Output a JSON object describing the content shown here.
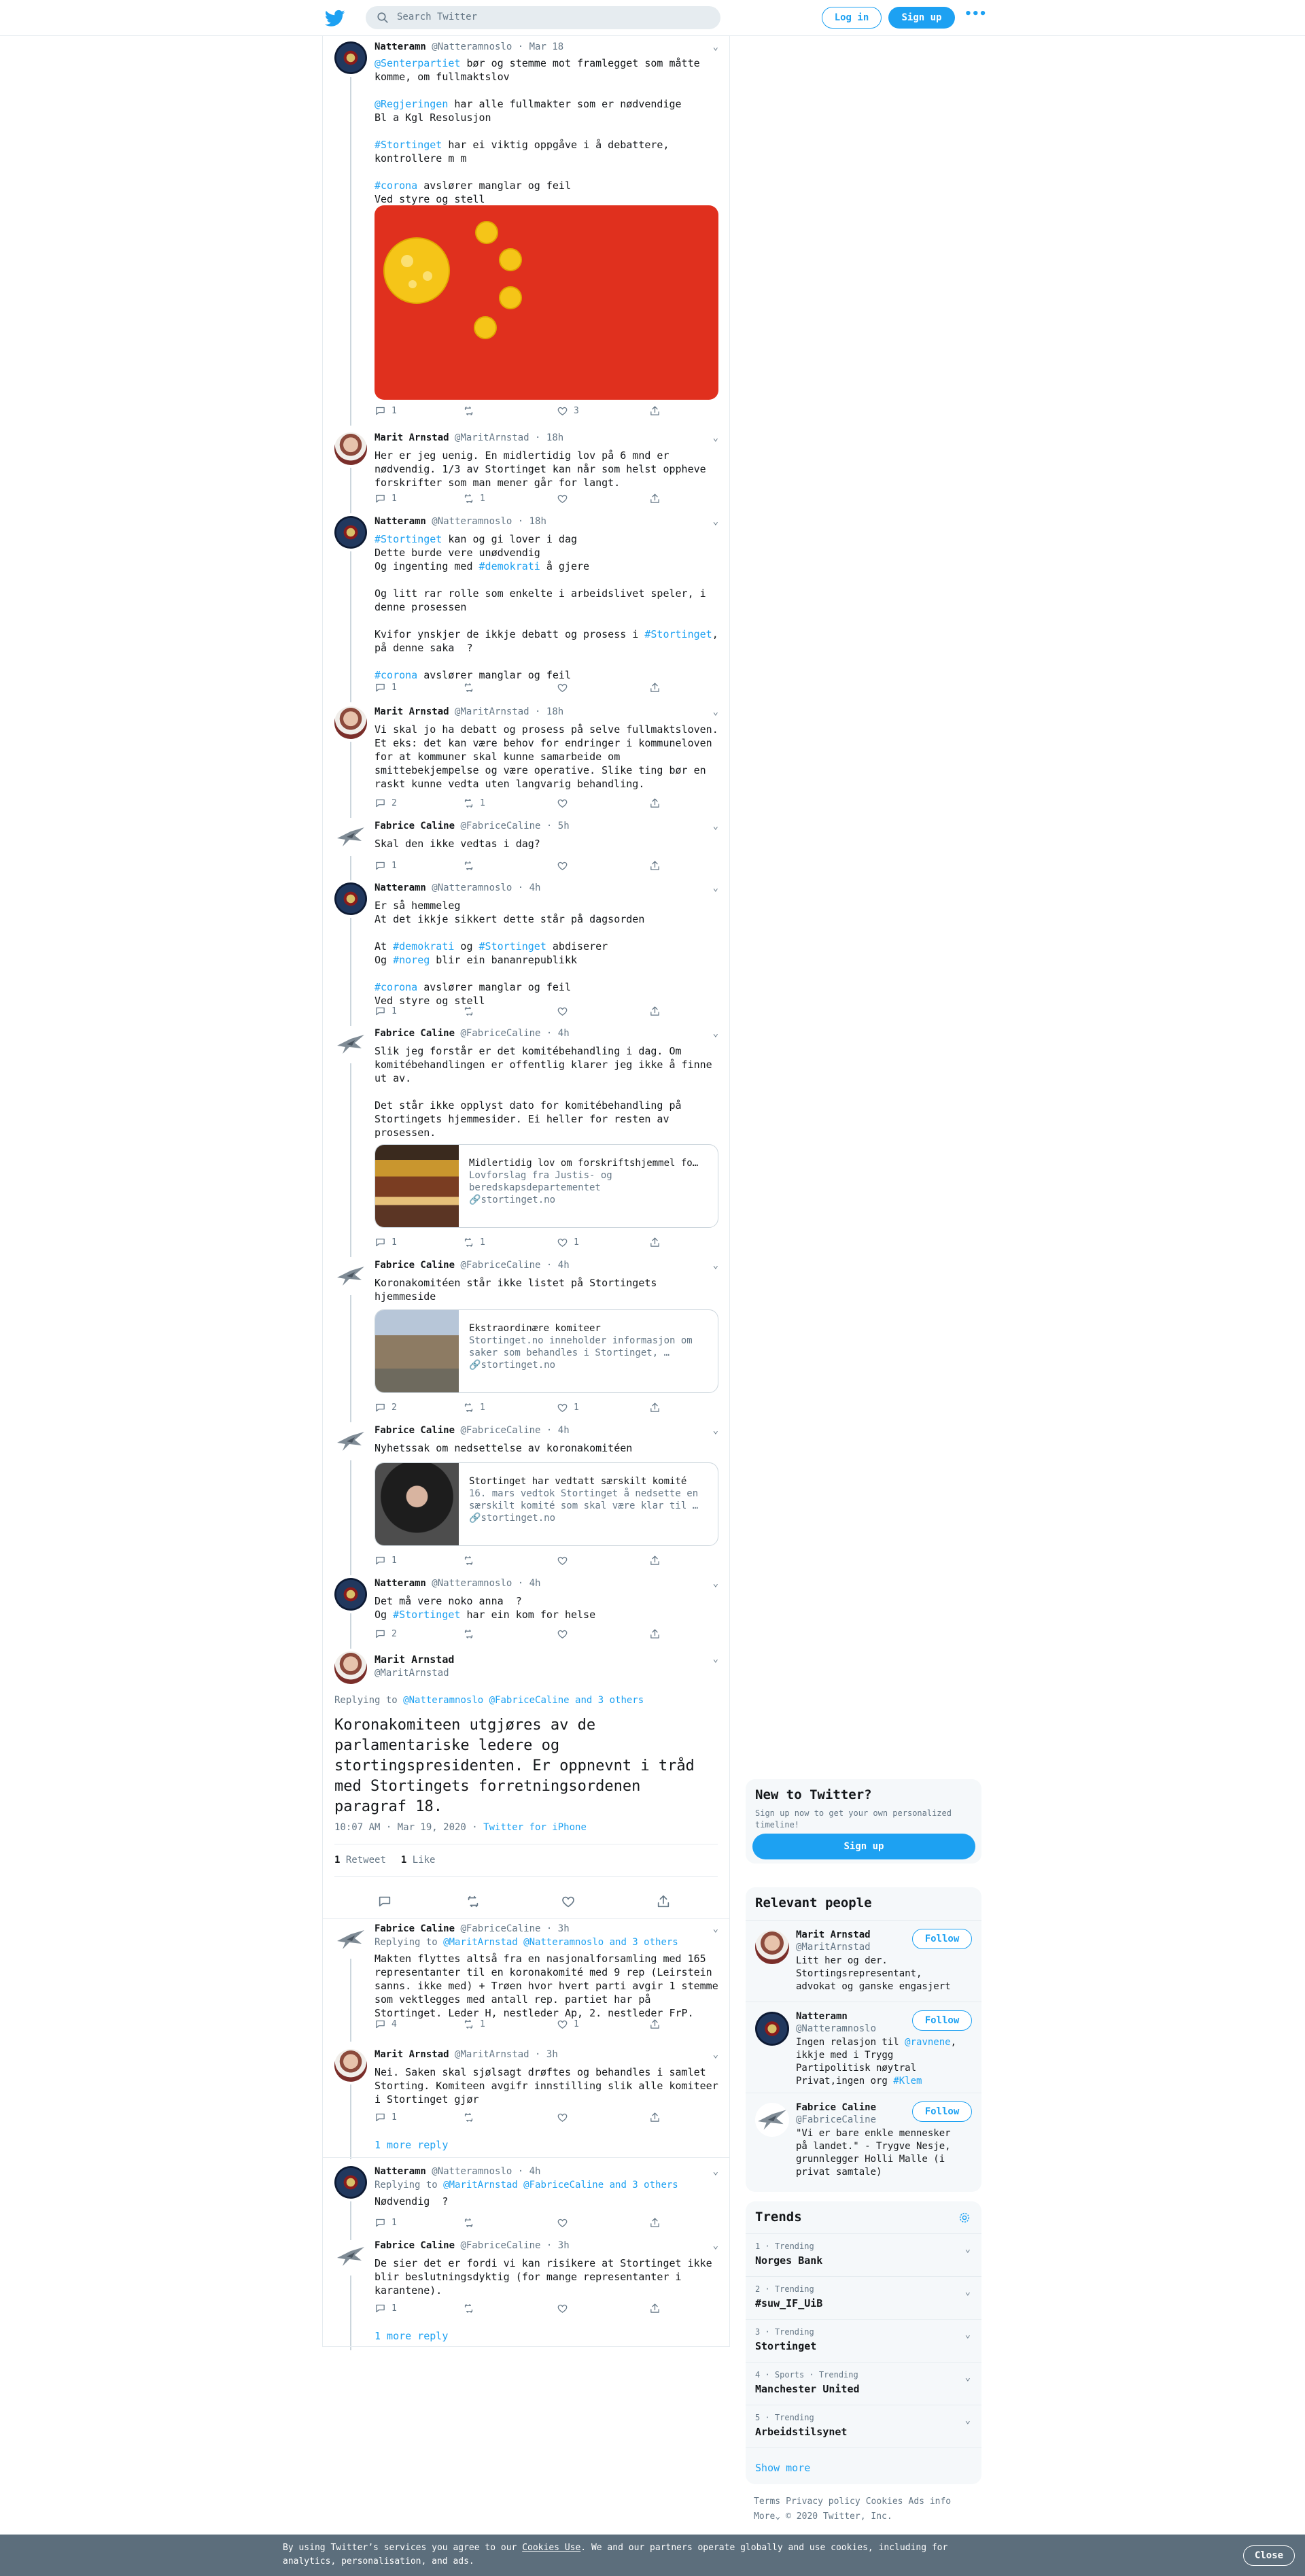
{
  "header": {
    "search_placeholder": "Search Twitter",
    "login_label": "Log in",
    "signup_label": "Sign up",
    "more_label": "•••",
    "icons": {
      "logo": "twitter-bird-icon",
      "search": "search-icon"
    }
  },
  "colors": {
    "accent": "#1da1f2",
    "text": "#14171a",
    "muted": "#657786",
    "border": "#e6ecf0",
    "cookie_bg": "#5c6e7c"
  },
  "tweets": [
    {
      "name": "Natteramn",
      "handle": "@Natteramnoslo",
      "time": "· Mar 18",
      "segments": [
        [
          {
            "t": "@Senterpartiet",
            "l": true
          },
          {
            "t": " bør og stemme mot framlegget som måtte komme, om fullmaktslov"
          }
        ],
        [
          {
            "t": ""
          }
        ],
        [
          {
            "t": "@Regjeringen",
            "l": true
          },
          {
            "t": " har alle fullmakter som er nødvendige"
          }
        ],
        [
          {
            "t": "Bl a Kgl Resolusjon"
          }
        ],
        [
          {
            "t": ""
          }
        ],
        [
          {
            "t": "#Stortinget",
            "l": true
          },
          {
            "t": " har ei viktig oppgåve i å debattere, kontrollere m m"
          }
        ],
        [
          {
            "t": ""
          }
        ],
        [
          {
            "t": "#corona",
            "l": true
          },
          {
            "t": " avslører manglar og feil"
          }
        ],
        [
          {
            "t": "Ved styre og stell"
          }
        ]
      ],
      "replies": "1",
      "retweets": "",
      "likes": "3"
    },
    {
      "name": "Marit Arnstad",
      "handle": "@MaritArnstad",
      "time": "· 18h",
      "segments": [
        [
          {
            "t": "Her er jeg uenig. En midlertidig lov på 6 mnd er nødvendig. 1/3 av Stortinget kan når som helst oppheve forskrifter som man mener går for langt."
          }
        ]
      ],
      "replies": "1",
      "retweets": "1",
      "likes": ""
    },
    {
      "name": "Natteramn",
      "handle": "@Natteramnoslo",
      "time": "· 18h",
      "segments": [
        [
          {
            "t": "#Stortinget",
            "l": true
          },
          {
            "t": " kan og gi lover i dag"
          }
        ],
        [
          {
            "t": "Dette burde vere unødvendig"
          }
        ],
        [
          {
            "t": "Og ingenting med "
          },
          {
            "t": "#demokrati",
            "l": true
          },
          {
            "t": " å gjere"
          }
        ],
        [
          {
            "t": ""
          }
        ],
        [
          {
            "t": "Og litt rar rolle som enkelte i arbeidslivet speler, i denne prosessen"
          }
        ],
        [
          {
            "t": ""
          }
        ],
        [
          {
            "t": "Kvifor ynskjer de ikkje debatt og prosess i "
          },
          {
            "t": "#Stortinget",
            "l": true
          },
          {
            "t": ", på denne saka  ?"
          }
        ],
        [
          {
            "t": ""
          }
        ],
        [
          {
            "t": "#corona",
            "l": true
          },
          {
            "t": " avslører manglar og feil"
          }
        ]
      ],
      "replies": "1",
      "retweets": "",
      "likes": ""
    },
    {
      "name": "Marit Arnstad",
      "handle": "@MaritArnstad",
      "time": "· 18h",
      "segments": [
        [
          {
            "t": "Vi skal jo ha debatt og prosess på selve fullmaktsloven. Et eks: det kan være behov for endringer i kommuneloven for at kommuner skal kunne samarbeide om smittebekjempelse og være operative. Slike ting bør en raskt kunne vedta uten langvarig behandling."
          }
        ]
      ],
      "replies": "2",
      "retweets": "1",
      "likes": ""
    },
    {
      "name": "Fabrice Caline",
      "handle": "@FabriceCaline",
      "time": "· 5h",
      "segments": [
        [
          {
            "t": "Skal den ikke vedtas i dag?"
          }
        ]
      ],
      "replies": "1",
      "retweets": "",
      "likes": ""
    },
    {
      "name": "Natteramn",
      "handle": "@Natteramnoslo",
      "time": "· 4h",
      "segments": [
        [
          {
            "t": "Er så hemmeleg"
          }
        ],
        [
          {
            "t": "At det ikkje sikkert dette står på dagsorden"
          }
        ],
        [
          {
            "t": ""
          }
        ],
        [
          {
            "t": "At "
          },
          {
            "t": "#demokrati",
            "l": true
          },
          {
            "t": " og "
          },
          {
            "t": "#Stortinget",
            "l": true
          },
          {
            "t": " abdiserer"
          }
        ],
        [
          {
            "t": "Og "
          },
          {
            "t": "#noreg",
            "l": true
          },
          {
            "t": " blir ein bananrepublikk"
          }
        ],
        [
          {
            "t": ""
          }
        ],
        [
          {
            "t": "#corona",
            "l": true
          },
          {
            "t": " avslører manglar og feil"
          }
        ],
        [
          {
            "t": "Ved styre og stell"
          }
        ]
      ],
      "replies": "1",
      "retweets": "",
      "likes": ""
    },
    {
      "name": "Fabrice Caline",
      "handle": "@FabriceCaline",
      "time": "· 4h",
      "segments": [
        [
          {
            "t": "Slik jeg forstår er det komitébehandling i dag. Om komitébehandlingen er offentlig klarer jeg ikke å finne ut av."
          }
        ],
        [
          {
            "t": ""
          }
        ],
        [
          {
            "t": "Det står ikke opplyst dato for komitébehandling på Stortingets hjemmesider. Ei heller for resten av prosessen."
          }
        ]
      ],
      "card": {
        "title": "Midlertidig lov om forskriftshjemmel fo…",
        "desc": "Lovforslag fra Justis- og beredskapsdepartementet",
        "url": "stortinget.no"
      },
      "replies": "1",
      "retweets": "1",
      "likes": "1"
    },
    {
      "name": "Fabrice Caline",
      "handle": "@FabriceCaline",
      "time": "· 4h",
      "segments": [
        [
          {
            "t": "Koronakomitéen står ikke listet på Stortingets hjemmeside"
          }
        ]
      ],
      "card": {
        "title": "Ekstraordinære komiteer",
        "desc": "Stortinget.no inneholder informasjon om saker som behandles i Stortinget, …",
        "url": "stortinget.no"
      },
      "replies": "2",
      "retweets": "1",
      "likes": "1"
    },
    {
      "name": "Fabrice Caline",
      "handle": "@FabriceCaline",
      "time": "· 4h",
      "segments": [
        [
          {
            "t": "Nyhetssak om nedsettelse av koronakomitéen"
          }
        ]
      ],
      "card": {
        "title": "Stortinget har vedtatt særskilt komité",
        "desc": "16. mars vedtok Stortinget å nedsette en særskilt komité som skal være klar til …",
        "url": "stortinget.no"
      },
      "replies": "1",
      "retweets": "",
      "likes": ""
    },
    {
      "name": "Natteramn",
      "handle": "@Natteramnoslo",
      "time": "· 4h",
      "segments": [
        [
          {
            "t": "Det må vere noko anna  ?"
          }
        ],
        [
          {
            "t": "Og "
          },
          {
            "t": "#Stortinget",
            "l": true
          },
          {
            "t": " har ein kom for helse"
          }
        ]
      ],
      "replies": "2",
      "retweets": "",
      "likes": ""
    }
  ],
  "focus": {
    "name": "Marit Arnstad",
    "handle": "@MaritArnstad",
    "replying_prefix": "Replying to ",
    "replying_to": "@Natteramnoslo @FabriceCaline and 3 others",
    "text": "Koronakomiteen utgjøres av de parlamentariske ledere og stortingspresidenten. Er oppnevnt i tråd med Stortingets forretningsordenen paragraf 18.",
    "timestamp": "10:07 AM · Mar 19, 2020 · ",
    "source": "Twitter for iPhone",
    "retweets_count": "1",
    "retweets_label": "Retweet",
    "likes_count": "1",
    "likes_label": "Like"
  },
  "replies": [
    {
      "name": "Fabrice Caline",
      "handle": "@FabriceCaline",
      "time": "· 3h",
      "replying_prefix": "Replying to ",
      "replying_to": "@MaritArnstad @Natteramnoslo and 3 others",
      "text": "Makten flyttes altså fra en nasjonalforsamling med 165 representanter til en koronakomité med 9 rep (Leirstein sanns. ikke med) + Trøen hvor hvert parti avgir 1 stemme som vektlegges med antall rep. partiet har på Stortinget. Leder H, nestleder Ap, 2. nestleder FrP.",
      "replies": "4",
      "retweets": "1",
      "likes": "1"
    },
    {
      "name": "Marit Arnstad",
      "handle": "@MaritArnstad",
      "time": "· 3h",
      "text": "Nei. Saken skal sjølsagt drøftes og behandles i samlet Storting. Komiteen avgifr innstilling slik alle komiteer i Stortinget gjør",
      "replies": "1",
      "retweets": "",
      "likes": ""
    },
    {
      "name": "Natteramn",
      "handle": "@Natteramnoslo",
      "time": "· 4h",
      "replying_prefix": "Replying to ",
      "replying_to": "@MaritArnstad @FabriceCaline and 3 others",
      "text": "Nødvendig  ?",
      "replies": "1",
      "retweets": "",
      "likes": ""
    },
    {
      "name": "Fabrice Caline",
      "handle": "@FabriceCaline",
      "time": "· 3h",
      "text": "De sier det er fordi vi kan risikere at Stortinget ikke blir beslutningsdyktig (for mange representanter i karantene).",
      "replies": "1",
      "retweets": "",
      "likes": ""
    }
  ],
  "more_reply_label": "1 more reply",
  "sidebar": {
    "new_title": "New to Twitter?",
    "new_desc": "Sign up now to get your own personalized timeline!",
    "new_signup": "Sign up",
    "relevant_title": "Relevant people",
    "follow_label": "Follow",
    "people": [
      {
        "name": "Marit Arnstad",
        "handle": "@MaritArnstad",
        "bio": [
          {
            "t": "Litt her og der. Stortingsrepresentant, advokat og ganske engasjert"
          }
        ]
      },
      {
        "name": "Natteramn",
        "handle": "@Natteramnoslo",
        "bio": [
          {
            "t": "Ingen relasjon til "
          },
          {
            "t": "@ravnene",
            "l": true
          },
          {
            "t": ", ikkje med i Trygg Partipolitisk nøytral Privat,ingen org "
          },
          {
            "t": "#Klem",
            "l": true
          }
        ]
      },
      {
        "name": "Fabrice Caline",
        "handle": "@FabriceCaline",
        "bio": [
          {
            "t": "\"Vi er bare enkle mennesker på landet.\" - Trygve Nesje, grunnlegger Holli Malle (i privat samtale)"
          }
        ]
      }
    ],
    "trends_title": "Trends",
    "trends": [
      {
        "meta": "1 · Trending",
        "name": "Norges Bank"
      },
      {
        "meta": "2 · Trending",
        "name": "#suw_IF_UiB"
      },
      {
        "meta": "3 · Trending",
        "name": "Stortinget"
      },
      {
        "meta": "4 · Sports · Trending",
        "name": "Manchester United"
      },
      {
        "meta": "5 · Trending",
        "name": "Arbeidstilsynet"
      }
    ],
    "show_more": "Show more",
    "footer_links": [
      "Terms",
      "Privacy policy",
      "Cookies",
      "Ads info"
    ],
    "footer_more": "More",
    "copyright": "© 2020 Twitter, Inc."
  },
  "cookie": {
    "text_a": "By using Twitter’s services you agree to our ",
    "link": "Cookies Use",
    "text_b": ". We and our partners operate globally and use cookies, including for analytics, personalisation, and ads.",
    "close": "Close"
  }
}
